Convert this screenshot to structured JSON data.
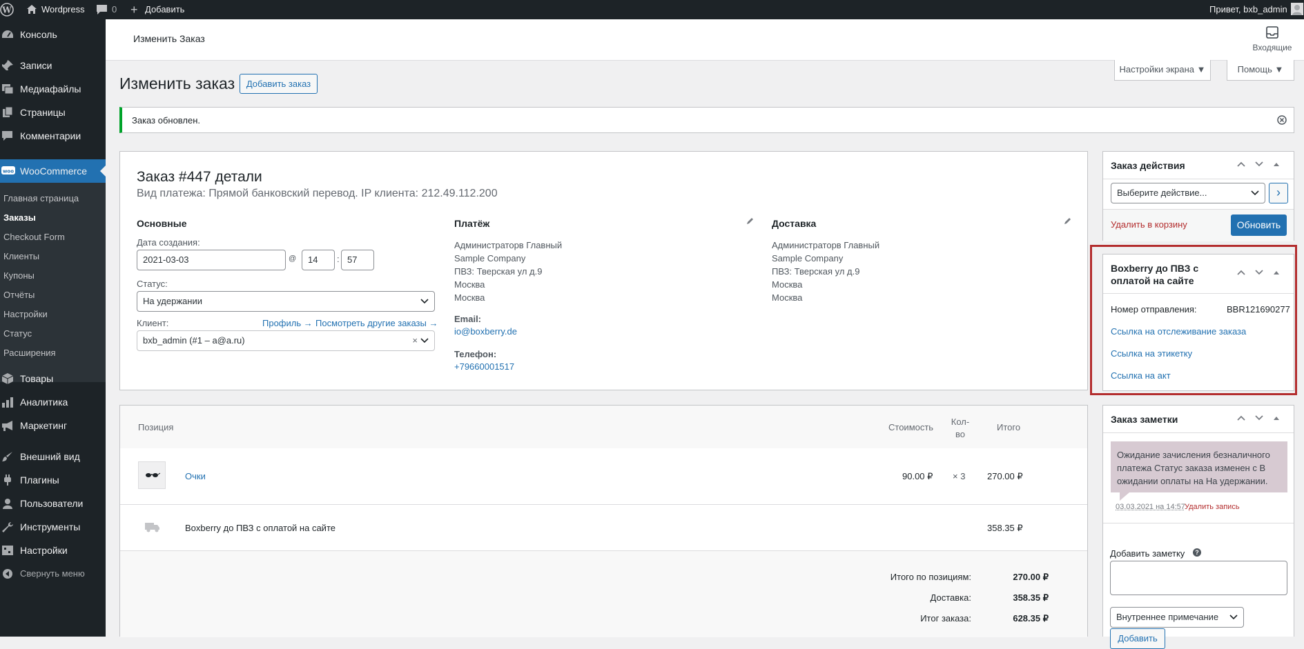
{
  "adminbar": {
    "site_name": "Wordpress",
    "comments_count": "0",
    "add_new": "Добавить",
    "greeting": "Привет, bxb_admin"
  },
  "sidebar": {
    "top_items": [
      "Консоль",
      "Записи",
      "Медиафайлы",
      "Страницы",
      "Комментарии",
      "WooCommerce"
    ],
    "woo_submenu": [
      "Главная страница",
      "Заказы",
      "Checkout Form",
      "Клиенты",
      "Купоны",
      "Отчёты",
      "Настройки",
      "Статус",
      "Расширения"
    ],
    "bottom_items": [
      "Товары",
      "Аналитика",
      "Маркетинг",
      "Внешний вид",
      "Плагины",
      "Пользователи",
      "Инструменты",
      "Настройки"
    ],
    "collapse": "Свернуть меню"
  },
  "header": {
    "title": "Изменить Заказ",
    "inbox": "Входящие"
  },
  "screen_options": "Настройки экрана ▼",
  "help": "Помощь ▼",
  "page": {
    "title": "Изменить заказ",
    "add_order": "Добавить заказ",
    "notice": "Заказ обновлен."
  },
  "order": {
    "heading": "Заказ #447 детали",
    "subheading": "Вид платежа: Прямой банковский перевод. IP клиента: 212.49.112.200",
    "general": {
      "title": "Основные",
      "date_label": "Дата создания:",
      "date": "2021-03-03",
      "at": "@",
      "hour": "14",
      "colon": ":",
      "minute": "57",
      "status_label": "Статус:",
      "status": "На удержании",
      "client_label": "Клиент:",
      "profile_link": "Профиль →",
      "other_orders_link": "Посмотреть другие заказы →",
      "client": "bxb_admin (#1 – a@a.ru)",
      "clear": "×"
    },
    "billing": {
      "title": "Платёж",
      "address": [
        "Администраторв Главный",
        "Sample Company",
        "ПВЗ: Тверская ул д.9",
        "Москва",
        "Москва"
      ],
      "email_label": "Email:",
      "email": "io@boxberry.de",
      "phone_label": "Телефон:",
      "phone": "+79660001517"
    },
    "shipping": {
      "title": "Доставка",
      "address": [
        "Администраторв Главный",
        "Sample Company",
        "ПВЗ: Тверская ул д.9",
        "Москва",
        "Москва"
      ]
    }
  },
  "items": {
    "headers": {
      "item": "Позиция",
      "cost": "Стоимость",
      "qty": "Кол-во",
      "total": "Итого"
    },
    "rows": [
      {
        "name": "Очки",
        "cost": "90.00 ₽",
        "qty": "× 3",
        "total": "270.00 ₽"
      }
    ],
    "shipping_row": {
      "name": "Boxberry до ПВЗ с оплатой на сайте",
      "total": "358.35 ₽"
    },
    "totals": [
      {
        "label": "Итого по позициям:",
        "value": "270.00 ₽"
      },
      {
        "label": "Доставка:",
        "value": "358.35 ₽"
      },
      {
        "label": "Итог заказа:",
        "value": "628.35 ₽"
      }
    ]
  },
  "actions_box": {
    "title": "Заказ действия",
    "select": "Выберите действие...",
    "go": "›",
    "trash": "Удалить в корзину",
    "update": "Обновить"
  },
  "boxberry_box": {
    "title_line1": "Boxberry до ПВЗ с",
    "title_line2": "оплатой на сайте",
    "tracking_label": "Номер отправления:",
    "tracking_number": "BBR121690277",
    "links": [
      "Ссылка на отслеживание заказа",
      "Ссылка на этикетку",
      "Ссылка на акт"
    ],
    "highlight_color": "#b32d2e"
  },
  "notes_box": {
    "title": "Заказ заметки",
    "note_text": "Ожидание зачисления безналичного платежа Статус заказа изменен с В ожидании оплаты на На удержании.",
    "note_date": "03.03.2021 на 14:57",
    "delete_note": "Удалить запись",
    "add_label": "Добавить заметку",
    "help_icon": "?",
    "type": "Внутреннее примечание",
    "add_button": "Добавить"
  },
  "colors": {
    "sidebar": "#1d2327",
    "accent": "#2271b1",
    "notice_border": "#00a32a",
    "note_bg": "#d7cad2"
  }
}
